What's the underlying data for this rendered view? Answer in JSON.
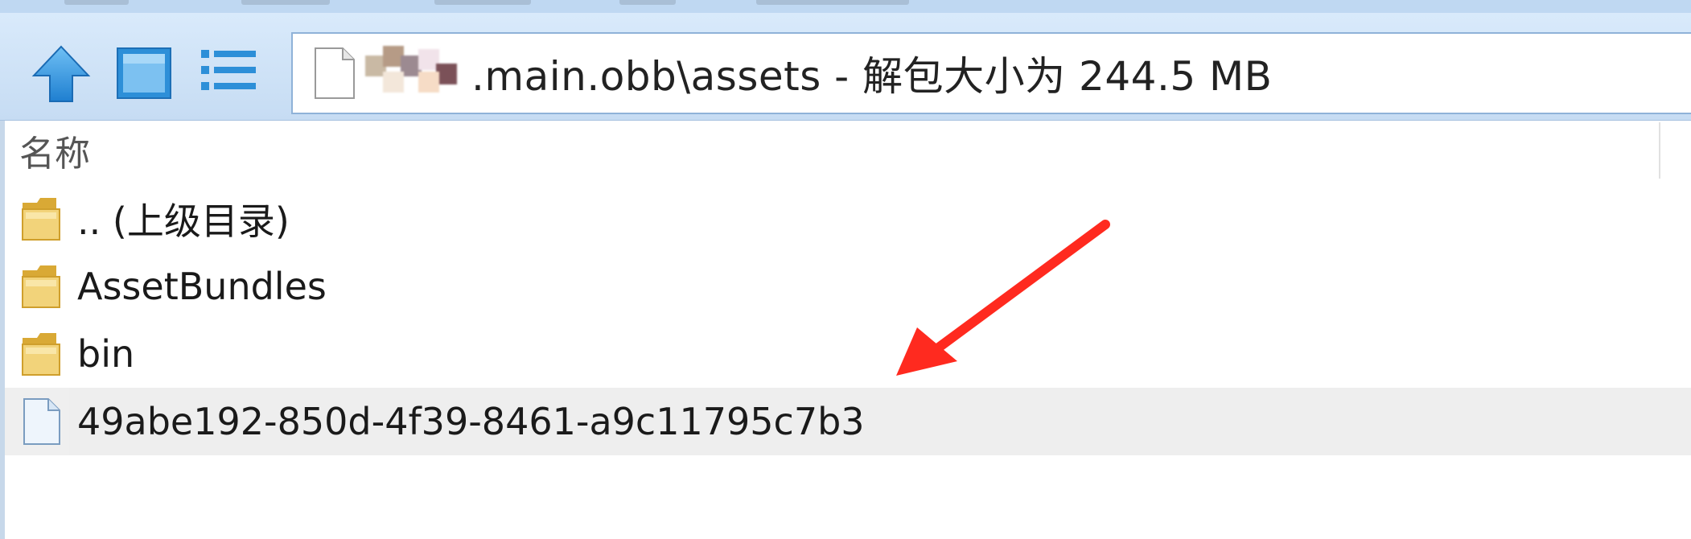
{
  "address_bar": {
    "path_suffix": ".main.obb\\assets - 解包大小为 244.5 MB"
  },
  "columns": {
    "name": "名称"
  },
  "files": [
    {
      "label": ".. (上级目录)",
      "icon": "folder-icon"
    },
    {
      "label": "AssetBundles",
      "icon": "folder-icon"
    },
    {
      "label": "bin",
      "icon": "folder-icon"
    },
    {
      "label": "49abe192-850d-4f39-8461-a9c11795c7b3",
      "icon": "file-icon"
    }
  ],
  "icons": {
    "toolbar_up": "arrow-up-icon",
    "toolbar_view": "large-icons-view-icon",
    "toolbar_details": "details-view-icon",
    "annotation": "red-arrow-icon"
  },
  "colors": {
    "toolbar_bg": "#cfe3f8",
    "icon_blue": "#2d8fd8",
    "folder_yellow": "#e9c45a",
    "annotation_red": "#ff2a1f"
  }
}
